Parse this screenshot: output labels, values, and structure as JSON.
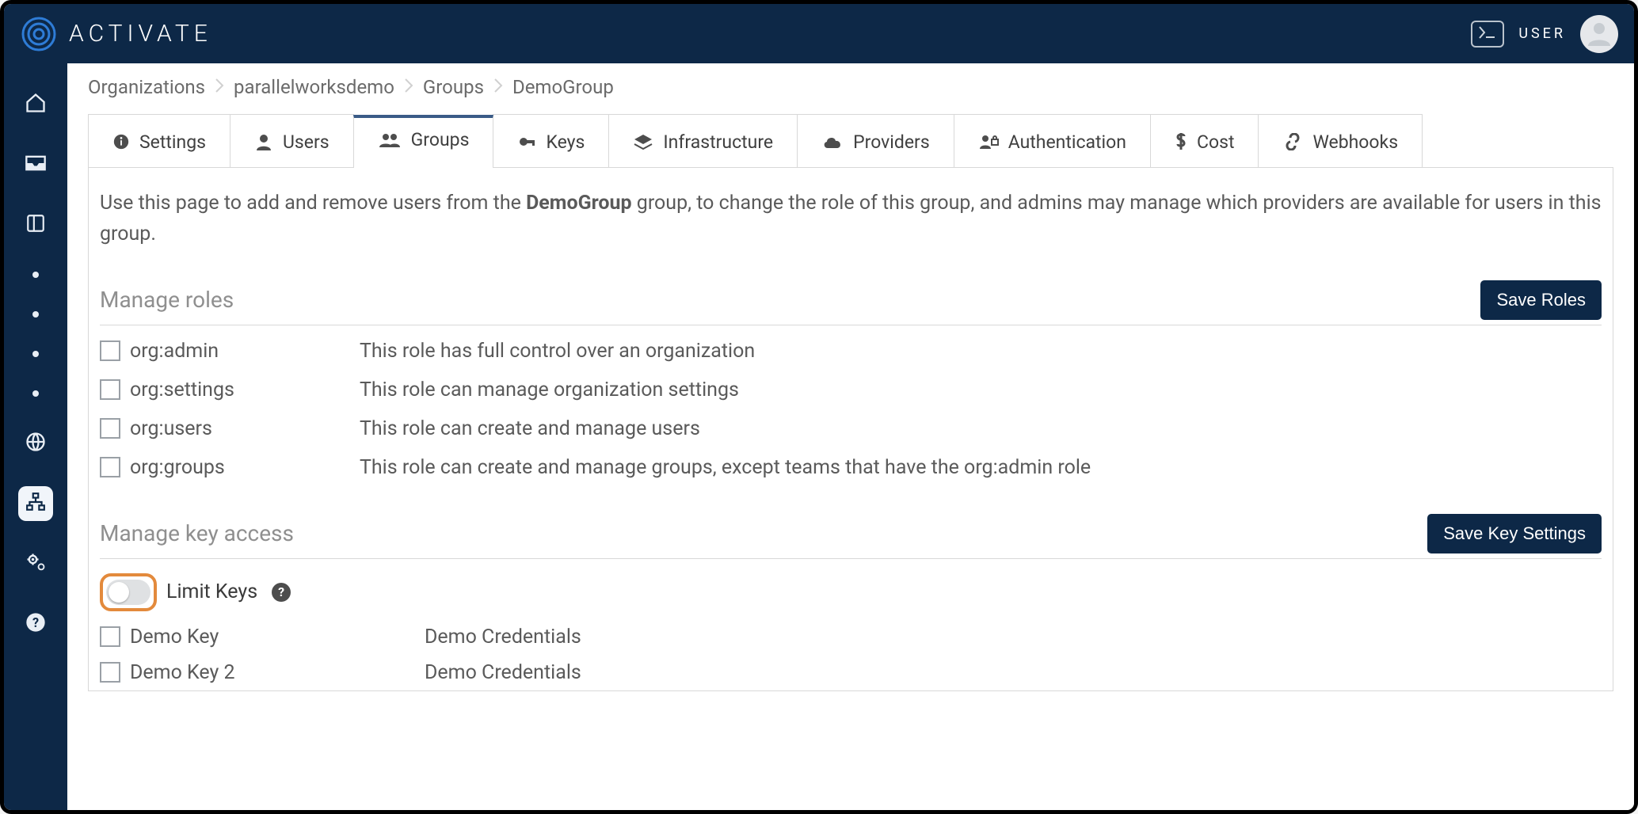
{
  "brand": "ACTIVATE",
  "header": {
    "user_label": "USER"
  },
  "breadcrumbs": [
    "Organizations",
    "parallelworksdemo",
    "Groups",
    "DemoGroup"
  ],
  "tabs": [
    {
      "label": "Settings"
    },
    {
      "label": "Users"
    },
    {
      "label": "Groups"
    },
    {
      "label": "Keys"
    },
    {
      "label": "Infrastructure"
    },
    {
      "label": "Providers"
    },
    {
      "label": "Authentication"
    },
    {
      "label": "Cost"
    },
    {
      "label": "Webhooks"
    }
  ],
  "intro": {
    "pre": "Use this page to add and remove users from the ",
    "strong": "DemoGroup",
    "post": " group, to change the role of this group, and admins may manage which providers are available for users in this group."
  },
  "roles": {
    "title": "Manage roles",
    "save_label": "Save Roles",
    "items": [
      {
        "name": "org:admin",
        "desc": "This role has full control over an organization"
      },
      {
        "name": "org:settings",
        "desc": "This role can manage organization settings"
      },
      {
        "name": "org:users",
        "desc": "This role can create and manage users"
      },
      {
        "name": "org:groups",
        "desc": "This role can create and manage groups, except teams that have the org:admin role"
      }
    ]
  },
  "keys": {
    "title": "Manage key access",
    "save_label": "Save Key Settings",
    "limit_label": "Limit Keys",
    "items": [
      {
        "name": "Demo Key",
        "desc": "Demo Credentials"
      },
      {
        "name": "Demo Key 2",
        "desc": "Demo Credentials"
      }
    ]
  }
}
